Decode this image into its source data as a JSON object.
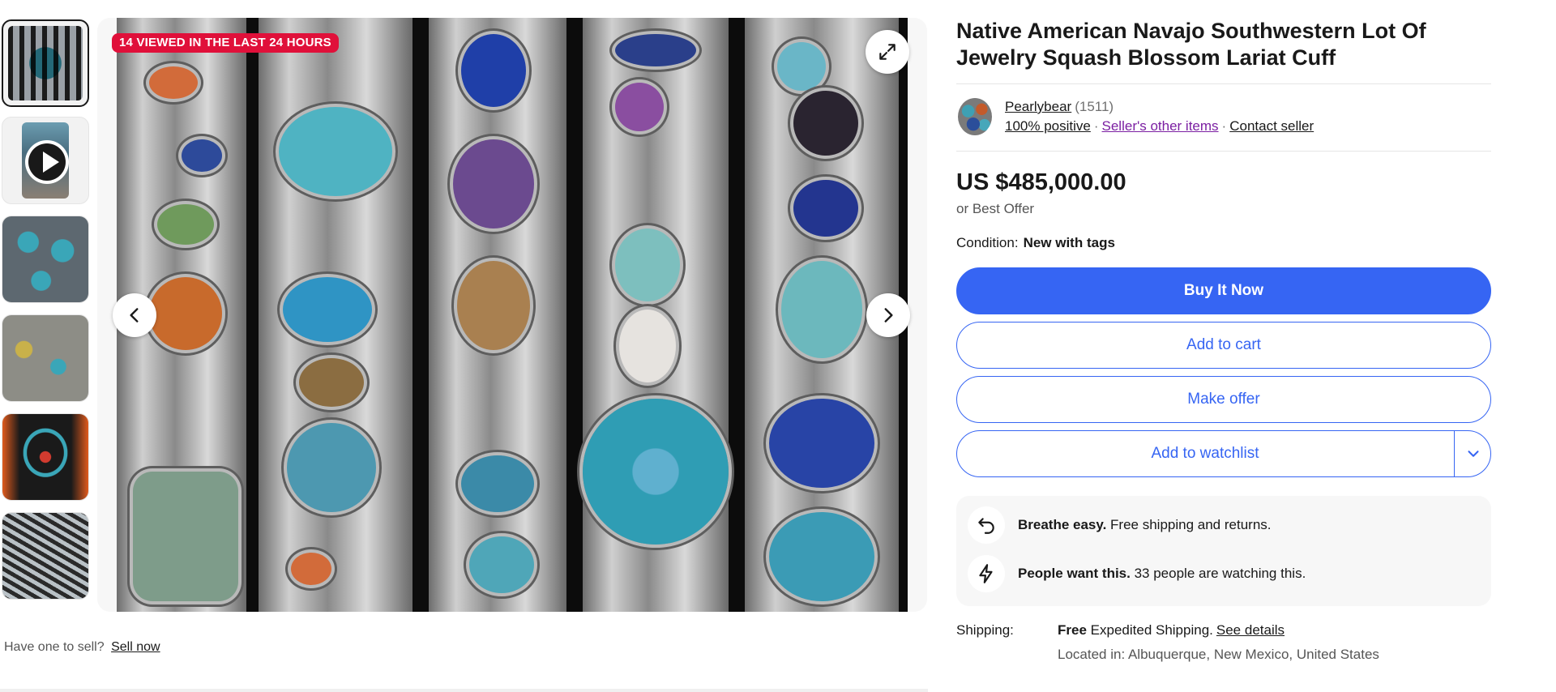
{
  "gallery": {
    "badge": "14 VIEWED IN THE LAST 24 HOURS",
    "thumbnails": [
      "jewelry-lot",
      "video",
      "squash-blossom",
      "cuff-pile",
      "necklace",
      "beads-lariat"
    ]
  },
  "footer": {
    "prompt": "Have one to sell?",
    "link": "Sell now"
  },
  "listing": {
    "title": "Native American Navajo Southwestern Lot Of Jewelry Squash Blossom Lariat Cuff",
    "seller": {
      "name": "Pearlybear",
      "feedback_count": "(1511)",
      "positive": "100% positive",
      "other_items": "Seller's other items",
      "contact": "Contact seller"
    },
    "price": "US $485,000.00",
    "best_offer": "or Best Offer",
    "condition_label": "Condition:",
    "condition_value": "New with tags",
    "buttons": {
      "buy_now": "Buy It Now",
      "add_to_cart": "Add to cart",
      "make_offer": "Make offer",
      "add_to_watchlist": "Add to watchlist"
    },
    "highlights": [
      {
        "bold": "Breathe easy.",
        "text": "Free shipping and returns.",
        "icon": "return-arrow-icon"
      },
      {
        "bold": "People want this.",
        "text": "33 people are watching this.",
        "icon": "lightning-icon"
      }
    ],
    "shipping": {
      "label": "Shipping:",
      "free": "Free",
      "method": "Expedited Shipping.",
      "details_link": "See details",
      "location": "Located in: Albuquerque, New Mexico, United States"
    }
  },
  "colors": {
    "accent": "#3665f3",
    "badge": "#e0103a",
    "link_visited": "#7b1fa2"
  }
}
